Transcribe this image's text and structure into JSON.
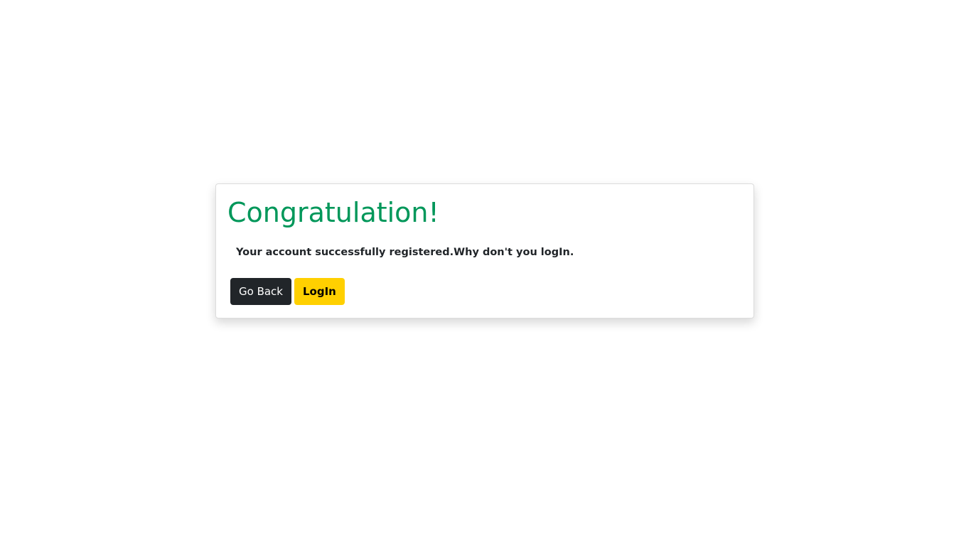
{
  "card": {
    "title": "Congratulation!",
    "message": "Your account successfully registered.Why don't you logIn.",
    "buttons": {
      "back_label": "Go Back",
      "login_label": "LogIn"
    }
  },
  "colors": {
    "title": "#00975a",
    "back_button": "#212529",
    "login_button": "#ffd000"
  }
}
